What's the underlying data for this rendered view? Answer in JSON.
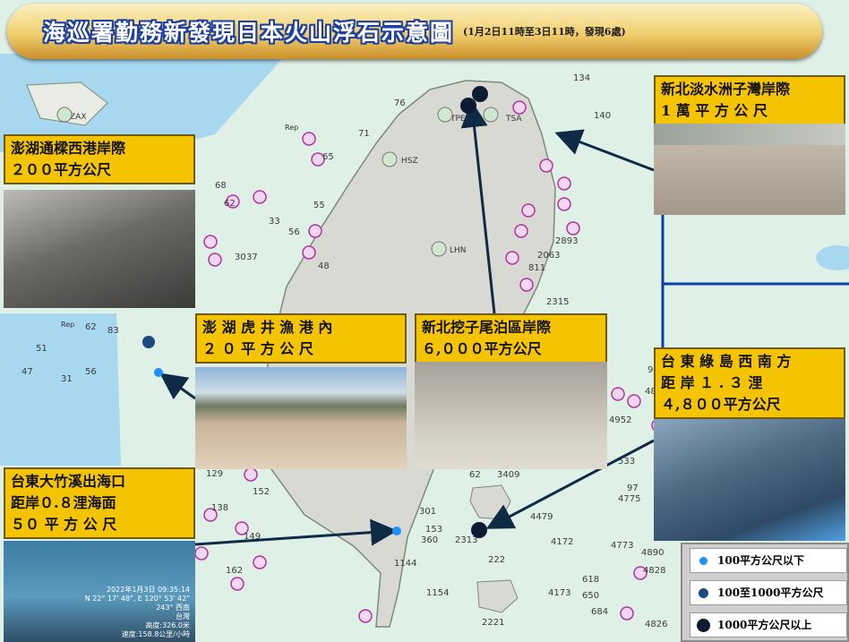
{
  "title": "海巡署勤務新發現日本火山浮石示意圖",
  "subtitle": "(1月2日11時至3日11時，發現6處)",
  "sites": [
    {
      "label": "新北淡水洲子灣岸際\n1 萬 平 方 公 尺",
      "marker": "large"
    },
    {
      "label": "澎湖通樑西港岸際\n２００平方公尺",
      "marker": "medium"
    },
    {
      "label": "澎 湖 虎 井 漁 港 內\n２ ０ 平 方 公 尺",
      "marker": "small"
    },
    {
      "label": "新北挖子尾泊區岸際\n６,０００平方公尺",
      "marker": "large"
    },
    {
      "label": "台 東 綠 島 西 南 方\n距 岸 １ . ３ 浬\n４,８００平方公尺",
      "marker": "large"
    },
    {
      "label": "台東大竹溪出海口\n距岸０.８浬海面\n５０ 平 方 公 尺",
      "marker": "small"
    }
  ],
  "photo_caption": {
    "line1": "2022年1月3日 09:35:14",
    "line2": "N 22° 17' 48\", E 120° 53' 42\"",
    "line3": "243° 西南",
    "line4": "台灣",
    "line5": "高度:326.0米",
    "line6": "速度:158.8公里/小時"
  },
  "map_labels": {
    "tpe": "TPE",
    "tsa": "TSA",
    "hsz": "HSZ",
    "lhn": "LHN",
    "zax": "ZAX",
    "rep1": "Rep",
    "rep2": "Rep",
    "soundings": [
      "134",
      "140",
      "76",
      "71",
      "65",
      "55",
      "48",
      "33",
      "56",
      "37",
      "30",
      "62",
      "51",
      "47",
      "31",
      "83",
      "62",
      "68",
      "56",
      "129",
      "138",
      "152",
      "149",
      "162",
      "2893",
      "2063",
      "811",
      "2315",
      "4952",
      "533",
      "4479",
      "4172",
      "4773",
      "4890",
      "4828",
      "2313",
      "360",
      "1144",
      "222",
      "1154",
      "2221",
      "684",
      "4173",
      "4826",
      "3409",
      "62",
      "301",
      "153",
      "4775",
      "618",
      "650",
      "97",
      "48",
      "96"
    ]
  },
  "legend": [
    {
      "label": "100平方公尺以下",
      "color": "#1e90ff",
      "size": "small"
    },
    {
      "label": "100至1000平方公尺",
      "color": "#1a4a80",
      "size": "medium"
    },
    {
      "label": "1000平方公尺以上",
      "color": "#0d1a33",
      "size": "large"
    }
  ],
  "colors": {
    "sea": "#dff0e6",
    "shallow": "#a8d8f0",
    "land": "#d9d9d3",
    "label_bg": "#f5c400",
    "arrow": "#0f2a45",
    "route": "#0b3fa8"
  }
}
